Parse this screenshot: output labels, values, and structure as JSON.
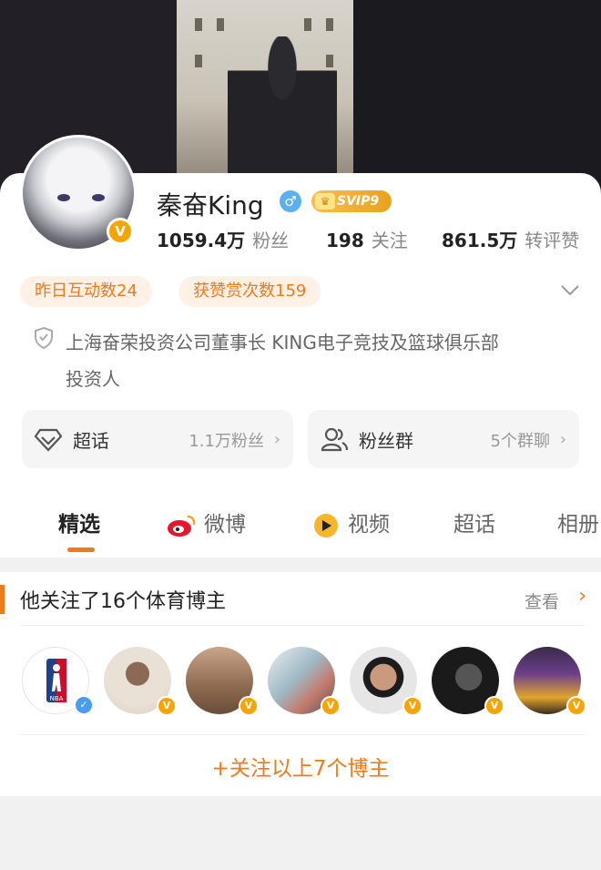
{
  "profile": {
    "name": "秦奋King",
    "svip_badge": "SVIP9",
    "verified_mark": "V",
    "gender_icon": "male-icon",
    "stats": [
      {
        "value": "1059.4万",
        "label": "粉丝"
      },
      {
        "value": "198",
        "label": "关注"
      },
      {
        "value": "861.5万",
        "label": "转评赞"
      }
    ],
    "pills": [
      "昨日互动数24",
      "获赞赏次数159"
    ],
    "bio_line1": "上海奋荣投资公司董事长 KING电子竞技及篮球俱乐部",
    "bio_line2": "投资人"
  },
  "boxes": [
    {
      "label": "超话",
      "meta": "1.1万粉丝",
      "icon": "diamond-icon"
    },
    {
      "label": "粉丝群",
      "meta": "5个群聊",
      "icon": "group-icon"
    }
  ],
  "tabs": [
    {
      "label": "精选",
      "active": true
    },
    {
      "label": "微博",
      "icon": "weibo-icon"
    },
    {
      "label": "视频",
      "icon": "video-icon"
    },
    {
      "label": "超话"
    },
    {
      "label": "相册"
    }
  ],
  "recommend": {
    "title": "他关注了16个体育博主",
    "more": "查看",
    "follow_all": "+关注以上7个博主",
    "accounts": [
      {
        "icon": "nba-logo-avatar",
        "badge_color": "#4a9cf0"
      },
      {
        "icon": "person-avatar",
        "badge_color": "#f8a400"
      },
      {
        "icon": "person-avatar",
        "badge_color": "#f8a400"
      },
      {
        "icon": "person-avatar",
        "badge_color": "#f8a400"
      },
      {
        "icon": "person-avatar",
        "badge_color": "#f8a400"
      },
      {
        "icon": "person-avatar",
        "badge_color": "#f8a400"
      },
      {
        "icon": "person-avatar",
        "badge_color": "#f8a400"
      }
    ]
  },
  "colors": {
    "accent": "#f07a1a",
    "verified": "#f8a400",
    "blue_verified": "#4a9cf0"
  }
}
